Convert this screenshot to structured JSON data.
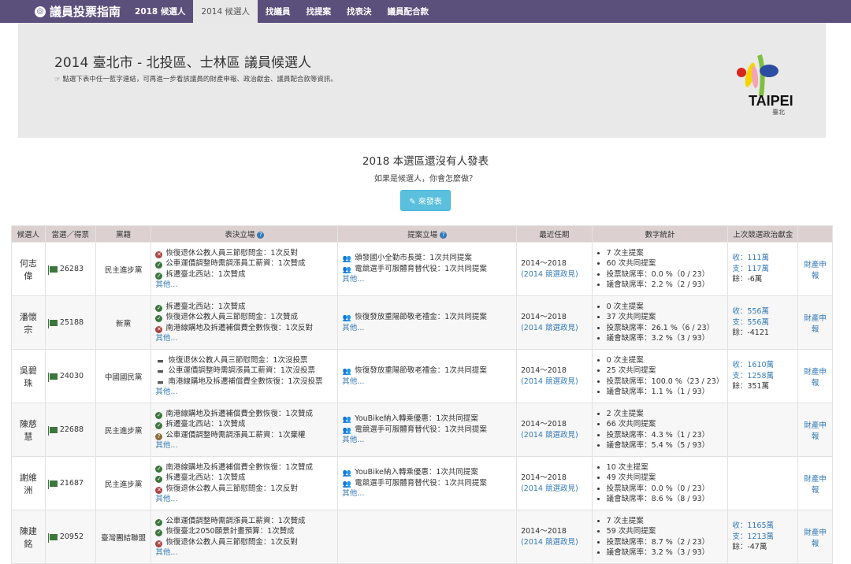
{
  "nav": {
    "brand": "議員投票指南",
    "items": [
      "2018 候選人",
      "2014 候選人",
      "找議員",
      "找提案",
      "找表決",
      "議員配合款"
    ],
    "active_index": 1
  },
  "header": {
    "title": "2014 臺北市 - 北投區、士林區 議員候選人",
    "hint": "☞ 點選下表中任一藍字連結，可再進一步看該議員的財產申報、政治獻金、議員配合款等資訊。",
    "logo_text": "TAIPEI",
    "logo_sub": "臺北"
  },
  "announce": {
    "title": "2018 本選區還沒有人發表",
    "subtitle": "如果是候選人，你會怎麼做？",
    "button": "來發表"
  },
  "table": {
    "headers": [
      "候選人",
      "當選／得票",
      "黨籍",
      "表決立場",
      "提案立場",
      "最近任期",
      "數字統計",
      "上次競選政治獻金",
      ""
    ],
    "rows": [
      {
        "name": "何志偉",
        "votes": "26283",
        "party": "民主進步黨",
        "stances": [
          {
            "icon": "no",
            "text": "恢復退休公教人員三節慰問金：1次反對"
          },
          {
            "icon": "ok",
            "text": "公車運價調整時需調漲員工薪資：1次贊成"
          },
          {
            "icon": "ok",
            "text": "拆遷臺北西站：1次贊成"
          }
        ],
        "proposals": [
          "頒發國小全勤市長獎：1次共同提案",
          "電競選手可服體育替代役：1次共同提案"
        ],
        "more": "其他...",
        "term": "2014～2018",
        "term_link": "(2014 競選政見)",
        "stats": [
          "7 次主提案",
          "60 次共同提案",
          "投票缺席率：0.0 %（0 / 23）",
          "議會缺席率：2.2 %（2 / 93）"
        ],
        "income": "收：111萬",
        "expense": "支：117萬",
        "remain": "餘：-6萬",
        "asset": "財產申報"
      },
      {
        "name": "潘懷宗",
        "votes": "25188",
        "party": "新黨",
        "stances": [
          {
            "icon": "ok",
            "text": "拆遷臺北西站：1次贊成"
          },
          {
            "icon": "ok",
            "text": "恢復退休公教人員三節慰問金：1次贊成"
          },
          {
            "icon": "no",
            "text": "南港線購地及拆遷補償費全數恢復：1次反對"
          }
        ],
        "proposals": [
          "恢復發放重陽節敬老禮金：1次共同提案"
        ],
        "more": "其他...",
        "term": "2014～2018",
        "term_link": "(2014 競選政見)",
        "stats": [
          "0 次主提案",
          "37 次共同提案",
          "投票缺席率：26.1 %（6 / 23）",
          "議會缺席率：3.2 %（3 / 93）"
        ],
        "income": "收：556萬",
        "expense": "支：556萬",
        "remain": "餘：-4121",
        "asset": "財產申報"
      },
      {
        "name": "吳碧珠",
        "votes": "24030",
        "party": "中國國民黨",
        "stances": [
          {
            "icon": "bed",
            "text": "恢復退休公教人員三節慰問金：1次沒投票"
          },
          {
            "icon": "bed",
            "text": "公車運價調整時需調漲員工薪資：1次沒投票"
          },
          {
            "icon": "bed",
            "text": "南港線購地及拆遷補償費全數恢復：1次沒投票"
          }
        ],
        "proposals": [
          "恢復發放重陽節敬老禮金：1次共同提案"
        ],
        "more": "其他...",
        "term": "2014～2018",
        "term_link": "(2014 競選政見)",
        "stats": [
          "0 次主提案",
          "25 次共同提案",
          "投票缺席率：100.0 %（23 / 23）",
          "議會缺席率：1.1 %（1 / 93）"
        ],
        "income": "收：1610萬",
        "expense": "支：1258萬",
        "remain": "餘：351萬",
        "asset": "財產申報"
      },
      {
        "name": "陳慈慧",
        "votes": "22688",
        "party": "民主進步黨",
        "stances": [
          {
            "icon": "ok",
            "text": "南港線購地及拆遷補償費全數恢復：1次贊成"
          },
          {
            "icon": "ok",
            "text": "拆遷臺北西站：1次贊成"
          },
          {
            "icon": "abs",
            "text": "公車運價調整時需調漲員工薪資：1次棄權"
          }
        ],
        "proposals": [
          "YouBike納入轉乘優惠：1次共同提案",
          "電競選手可服體育替代役：1次共同提案"
        ],
        "more": "其他...",
        "term": "2014～2018",
        "term_link": "(2014 競選政見)",
        "stats": [
          "2 次主提案",
          "66 次共同提案",
          "投票缺席率：4.3 %（1 / 23）",
          "議會缺席率：5.4 %（5 / 93）"
        ],
        "income": "",
        "expense": "",
        "remain": "",
        "asset": "財產申報"
      },
      {
        "name": "謝維洲",
        "votes": "21687",
        "party": "民主進步黨",
        "stances": [
          {
            "icon": "ok",
            "text": "南港線購地及拆遷補償費全數恢復：1次贊成"
          },
          {
            "icon": "ok",
            "text": "拆遷臺北西站：1次贊成"
          },
          {
            "icon": "no",
            "text": "恢復退休公教人員三節慰問金：1次反對"
          }
        ],
        "proposals": [
          "YouBike納入轉乘優惠：1次共同提案",
          "電競選手可服體育替代役：1次共同提案"
        ],
        "more": "其他...",
        "term": "2014～2018",
        "term_link": "(2014 競選政見)",
        "stats": [
          "10 次主提案",
          "49 次共同提案",
          "投票缺席率：0.0 %（0 / 23）",
          "議會缺席率：8.6 %（8 / 93）"
        ],
        "income": "",
        "expense": "",
        "remain": "",
        "asset": "財產申報"
      },
      {
        "name": "陳建銘",
        "votes": "20952",
        "party": "臺灣團結聯盟",
        "stances": [
          {
            "icon": "ok",
            "text": "公車運價調整時需調漲員工薪資：1次贊成"
          },
          {
            "icon": "ok",
            "text": "恢復臺北2050願景計畫預算：1次贊成"
          },
          {
            "icon": "no",
            "text": "恢復退休公教人員三節慰問金：1次反對"
          }
        ],
        "proposals": [],
        "more": "",
        "term": "2014～2018",
        "term_link": "(2014 競選政見)",
        "stats": [
          "7 次主提案",
          "59 次共同提案",
          "投票缺席率：8.7 %（2 / 23）",
          "議會缺席率：3.2 %（3 / 93）"
        ],
        "income": "收：1165萬",
        "expense": "支：1213萬",
        "remain": "餘：-47萬",
        "asset": "財產申報"
      }
    ],
    "stance_more": "其他..."
  }
}
